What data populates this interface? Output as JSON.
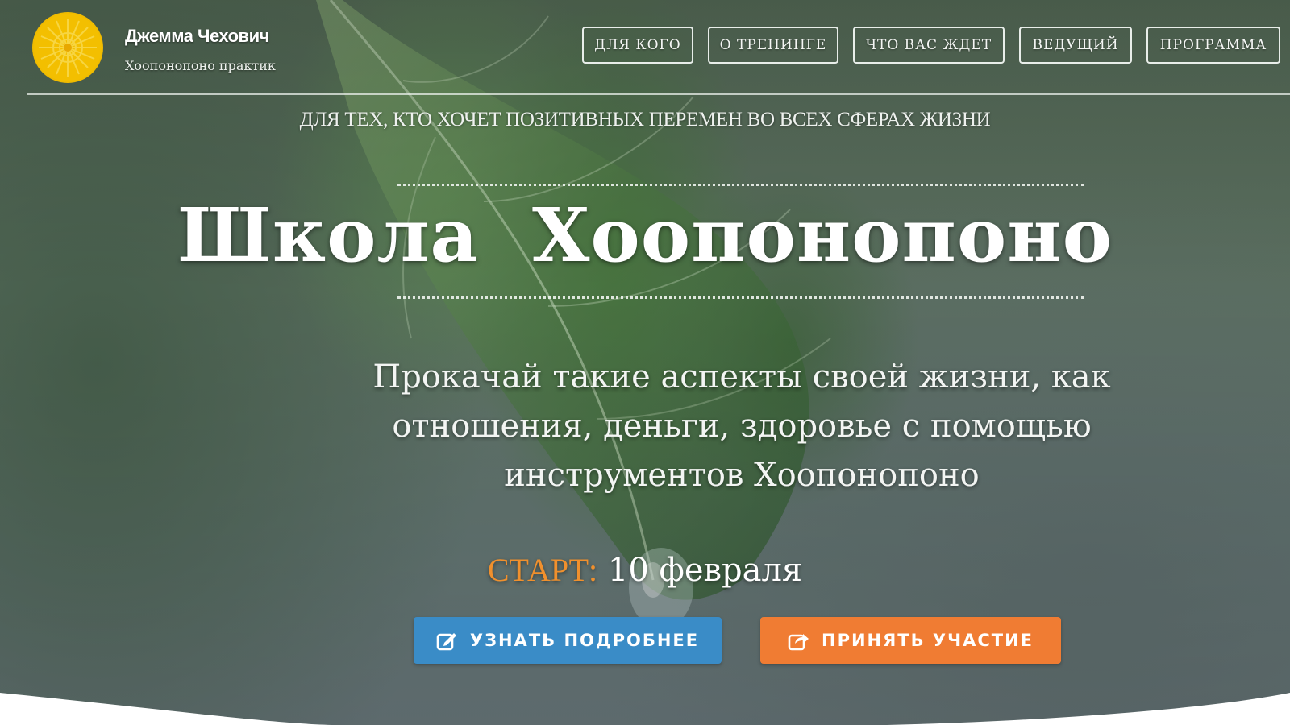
{
  "brand": {
    "name": "Джемма Чехович",
    "subtitle": "Хоопонопоно практик",
    "logo_icon": "sun-icon",
    "logo_color": "#f2bd00"
  },
  "nav": {
    "items": [
      {
        "label": "ДЛЯ КОГО"
      },
      {
        "label": "О ТРЕНИНГЕ"
      },
      {
        "label": "ЧТО ВАС ЖДЕТ"
      },
      {
        "label": "ВЕДУЩИЙ"
      },
      {
        "label": "ПРОГРАММА"
      }
    ]
  },
  "hero": {
    "tagline": "ДЛЯ ТЕХ, КТО ХОЧЕТ ПОЗИТИВНЫХ ПЕРЕМЕН ВО  ВСЕХ СФЕРАХ ЖИЗНИ",
    "title": "Школа  Хоопонопоно",
    "lead": "Прокачай такие аспекты своей жизни, как отношения, деньги, здоровье с помощью инструментов Хоопонопоно",
    "start_label": "СТАРТ:",
    "start_date": "10 февраля",
    "start_label_color": "#f0902d"
  },
  "buttons": {
    "learn_more": {
      "label": "УЗНАТЬ ПОДРОБНЕЕ",
      "icon": "edit-icon",
      "color": "#3a8cc7"
    },
    "join": {
      "label": "ПРИНЯТЬ УЧАСТИЕ",
      "icon": "share-icon",
      "color": "#f07c33"
    }
  }
}
